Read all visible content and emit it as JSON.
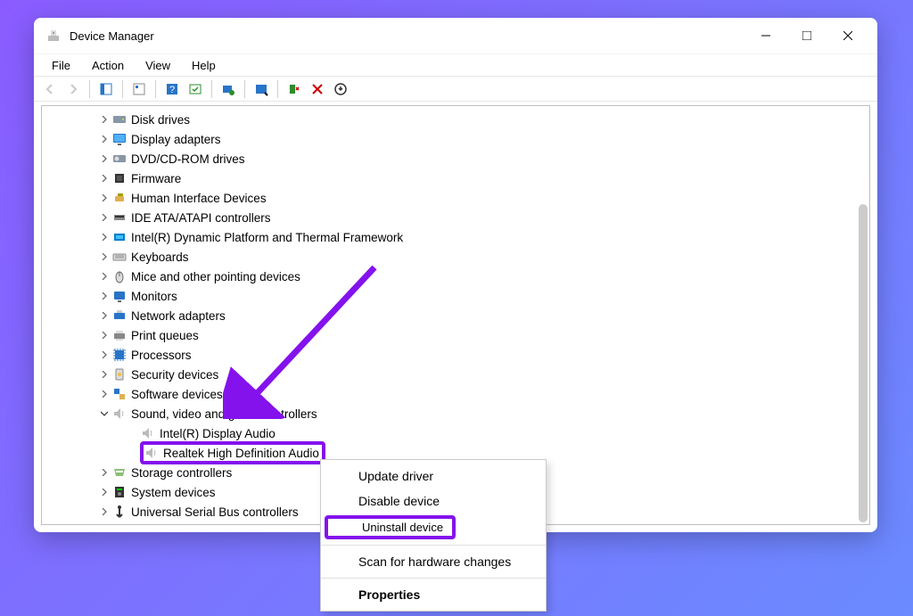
{
  "window": {
    "title": "Device Manager"
  },
  "menu": {
    "file": "File",
    "action": "Action",
    "view": "View",
    "help": "Help"
  },
  "tree": {
    "disk_drives": "Disk drives",
    "display_adapters": "Display adapters",
    "dvd": "DVD/CD-ROM drives",
    "firmware": "Firmware",
    "hid": "Human Interface Devices",
    "ide": "IDE ATA/ATAPI controllers",
    "intel_platform": "Intel(R) Dynamic Platform and Thermal Framework",
    "keyboards": "Keyboards",
    "mice": "Mice and other pointing devices",
    "monitors": "Monitors",
    "network": "Network adapters",
    "print_queues": "Print queues",
    "processors": "Processors",
    "security": "Security devices",
    "software": "Software devices",
    "sound": "Sound, video and game controllers",
    "sound_c1": "Intel(R) Display Audio",
    "sound_c2": "Realtek High Definition Audio",
    "storage": "Storage controllers",
    "system": "System devices",
    "usb": "Universal Serial Bus controllers"
  },
  "context_menu": {
    "update": "Update driver",
    "disable": "Disable device",
    "uninstall": "Uninstall device",
    "scan": "Scan for hardware changes",
    "properties": "Properties"
  }
}
